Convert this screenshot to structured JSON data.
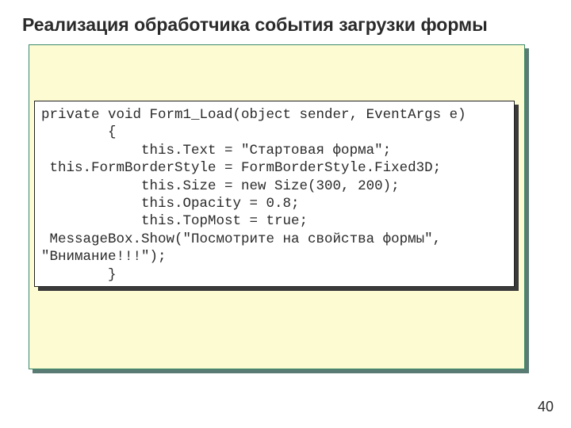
{
  "slide": {
    "title": "Реализация обработчика события загрузки формы",
    "page_number": "40"
  },
  "code": {
    "line1": "private void Form1_Load(object sender, EventArgs e)",
    "line2": "        {",
    "line3": "            this.Text = \"Стартовая форма\";",
    "line4": " this.FormBorderStyle = FormBorderStyle.Fixed3D;",
    "line5": "            this.Size = new Size(300, 200);",
    "line6": "            this.Opacity = 0.8;",
    "line7": "            this.TopMost = true;",
    "line8": " MessageBox.Show(\"Посмотрите на свойства формы\",",
    "line9": "\"Внимание!!!\");",
    "line10": "        }"
  }
}
